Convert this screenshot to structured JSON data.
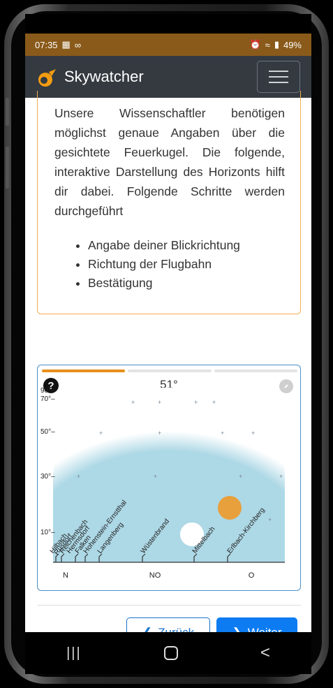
{
  "statusbar": {
    "time": "07:35",
    "left_icons": [
      "image-icon",
      "link-icon"
    ],
    "battery": "49%"
  },
  "navbar": {
    "brand": "Skywatcher",
    "menu_icon": "hamburger-icon"
  },
  "info": {
    "text": "Unsere Wissenschaftler benötigen möglichst genaue Angaben über die gesichtete Feuerkugel. Die folgende, interaktive Darstellung des Horizonts hilft dir dabei. Folgende Schritte werden durchgeführt",
    "steps": [
      "Angabe deiner Blickrichtung",
      "Richtung der Flugbahn",
      "Bestätigung"
    ]
  },
  "horizon": {
    "progress_steps": 3,
    "active_step": 1,
    "angle": "51°",
    "elevation_labels": [
      "90°–",
      "70°–",
      "50°–",
      "30°–",
      "10°–"
    ],
    "direction_labels": [
      "N",
      "NO",
      "O"
    ],
    "landmarks": [
      "Hilbach",
      "Rüsdorf",
      "Reichenbach",
      "Hermsdorf",
      "Falken",
      "Hohenstein-Ernstthal",
      "Langenberg",
      "Wüstenbrand",
      "Mittelbach",
      "Erlbach-Kirchberg"
    ],
    "colors": {
      "sky": "#add8e6",
      "sun": "#e8a03c",
      "moon": "#ffffff"
    }
  },
  "buttons": {
    "back": "Zurück",
    "next": "Weiter"
  },
  "system_nav": {
    "recents": "|||",
    "home": "home-icon",
    "back": "<"
  }
}
